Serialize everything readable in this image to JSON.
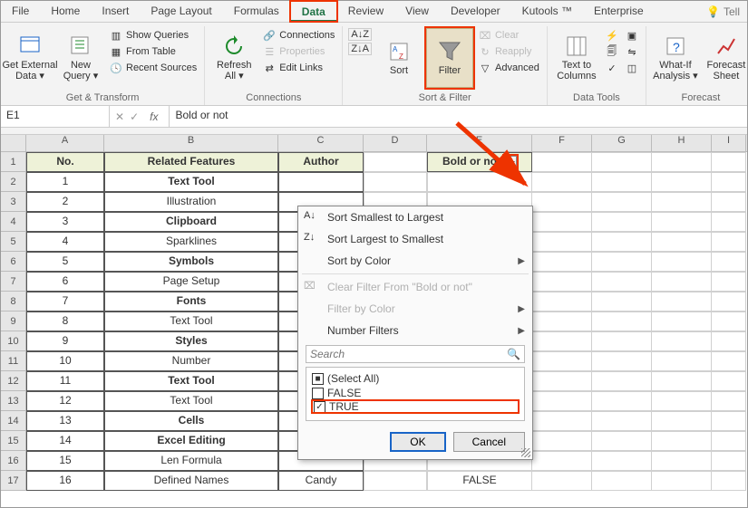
{
  "tabs": [
    "File",
    "Home",
    "Insert",
    "Page Layout",
    "Formulas",
    "Data",
    "Review",
    "View",
    "Developer",
    "Kutools ™",
    "Enterprise"
  ],
  "active_tab": "Data",
  "tell": "Tell",
  "ribbon": {
    "ext": {
      "getext": "Get External\nData ▾",
      "new": "New\nQuery ▾",
      "showq": "Show Queries",
      "fromt": "From Table",
      "recent": "Recent Sources",
      "label": "Get & Transform"
    },
    "conn": {
      "refresh": "Refresh\nAll ▾",
      "conns": "Connections",
      "props": "Properties",
      "edit": "Edit Links",
      "label": "Connections"
    },
    "sortf": {
      "sort": "Sort",
      "filter": "Filter",
      "clear": "Clear",
      "reapp": "Reapply",
      "adv": "Advanced",
      "label": "Sort & Filter"
    },
    "dtools": {
      "ttc": "Text to\nColumns",
      "label": "Data Tools"
    },
    "fc": {
      "what": "What-If\nAnalysis ▾",
      "fsheet": "Forecast\nSheet",
      "label": "Forecast"
    }
  },
  "namebox": "E1",
  "fx_label": "fx",
  "fx_value": "Bold or not",
  "cols": [
    "A",
    "B",
    "C",
    "D",
    "E",
    "F",
    "G",
    "H",
    "I"
  ],
  "headers": {
    "no": "No.",
    "rf": "Related Features",
    "au": "Author",
    "bn": "Bold or not"
  },
  "rows": [
    {
      "n": "1",
      "f": "Text Tool",
      "b": true,
      "au": "",
      "e": ""
    },
    {
      "n": "2",
      "f": "Illustration",
      "b": false,
      "au": "",
      "e": ""
    },
    {
      "n": "3",
      "f": "Clipboard",
      "b": true,
      "au": "",
      "e": ""
    },
    {
      "n": "4",
      "f": "Sparklines",
      "b": false,
      "au": "",
      "e": ""
    },
    {
      "n": "5",
      "f": "Symbols",
      "b": true,
      "au": "",
      "e": ""
    },
    {
      "n": "6",
      "f": "Page Setup",
      "b": false,
      "au": "",
      "e": ""
    },
    {
      "n": "7",
      "f": "Fonts",
      "b": true,
      "au": "",
      "e": ""
    },
    {
      "n": "8",
      "f": "Text Tool",
      "b": false,
      "au": "",
      "e": ""
    },
    {
      "n": "9",
      "f": "Styles",
      "b": true,
      "au": "",
      "e": ""
    },
    {
      "n": "10",
      "f": "Number",
      "b": false,
      "au": "",
      "e": ""
    },
    {
      "n": "11",
      "f": "Text Tool",
      "b": true,
      "au": "",
      "e": ""
    },
    {
      "n": "12",
      "f": "Text Tool",
      "b": false,
      "au": "",
      "e": ""
    },
    {
      "n": "13",
      "f": "Cells",
      "b": true,
      "au": "",
      "e": ""
    },
    {
      "n": "14",
      "f": "Excel Editing",
      "b": true,
      "au": "",
      "e": ""
    },
    {
      "n": "15",
      "f": "Len Formula",
      "b": false,
      "au": "",
      "e": ""
    },
    {
      "n": "16",
      "f": "Defined Names",
      "b": false,
      "au": "Candy",
      "e": "FALSE"
    }
  ],
  "filtermenu": {
    "sortA": "Sort Smallest to Largest",
    "sortD": "Sort Largest to Smallest",
    "sortColor": "Sort by Color",
    "clear": "Clear Filter From \"Bold or not\"",
    "fColor": "Filter by Color",
    "nFilters": "Number Filters",
    "search": "Search",
    "selall": "(Select All)",
    "false": "FALSE",
    "true": "TRUE",
    "ok": "OK",
    "cancel": "Cancel"
  }
}
